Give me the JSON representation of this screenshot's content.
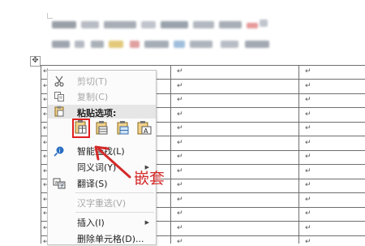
{
  "move_handle_glyph": "✥",
  "cell_mark": "↵",
  "menu": {
    "cut": {
      "label": "剪切(T)",
      "icon": "scissors-icon"
    },
    "copy": {
      "label": "复制(C)",
      "icon": "copy-icon"
    },
    "paste_options": {
      "label": "粘贴选项:",
      "icon": "clipboard-icon"
    },
    "paste_buttons": [
      {
        "name": "paste-nest-table-button",
        "icon": "paste-nest-icon",
        "selected": true
      },
      {
        "name": "paste-merge-table-button",
        "icon": "paste-merge-icon",
        "selected": false
      },
      {
        "name": "paste-rows-button",
        "icon": "paste-rows-icon",
        "selected": false
      },
      {
        "name": "paste-text-only-button",
        "icon": "paste-text-icon",
        "selected": false
      }
    ],
    "smart_lookup": {
      "label": "智能查找(L)",
      "icon": "smart-lookup-icon"
    },
    "synonyms": {
      "label": "同义词(Y)"
    },
    "translate": {
      "label": "翻译(S)",
      "icon": "translate-icon"
    },
    "han_reconversion": {
      "label": "汉字重选(V)"
    },
    "insert": {
      "label": "插入(I)"
    },
    "delete_cells": {
      "label": "删除单元格(D)..."
    }
  },
  "annotation": {
    "label": "嵌套",
    "color": "#d42a2a"
  },
  "colors": {
    "highlight_border": "#e02020",
    "menu_header_bg": "#e6e6e6"
  }
}
